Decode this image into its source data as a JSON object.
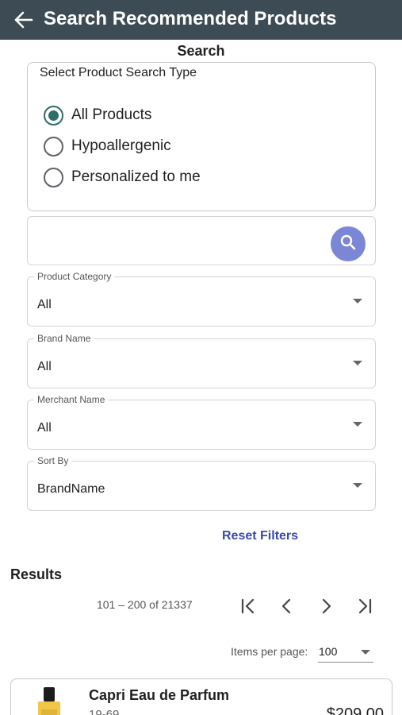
{
  "appbar": {
    "title": "Search Recommended Products",
    "back_icon": "arrow-left-icon"
  },
  "search_section": {
    "title": "Search"
  },
  "search_type": {
    "legend": "Select Product Search Type",
    "options": [
      {
        "label": "All Products",
        "checked": true
      },
      {
        "label": "Hypoallergenic",
        "checked": false
      },
      {
        "label": "Personalized to me",
        "checked": false
      }
    ]
  },
  "search": {
    "placeholder": "",
    "value": "",
    "button_icon": "search-icon",
    "button_color": "#7b87d6"
  },
  "filters": {
    "product_category": {
      "label": "Product Category",
      "value": "All"
    },
    "brand_name": {
      "label": "Brand Name",
      "value": "All"
    },
    "merchant_name": {
      "label": "Merchant Name",
      "value": "All"
    },
    "sort_by": {
      "label": "Sort By",
      "value": "BrandName"
    },
    "reset_label": "Reset Filters"
  },
  "results": {
    "title": "Results",
    "range_label": "101 – 200 of 21337",
    "items_per_page_label": "Items per page:",
    "items_per_page_value": "100"
  },
  "products": [
    {
      "name": "Capri Eau de Parfum",
      "subtitle": "19-69",
      "price": "$209.00"
    }
  ],
  "colors": {
    "appbar": "#3d4b54",
    "radio_accent": "#2e6e6a",
    "link": "#3949ab"
  }
}
